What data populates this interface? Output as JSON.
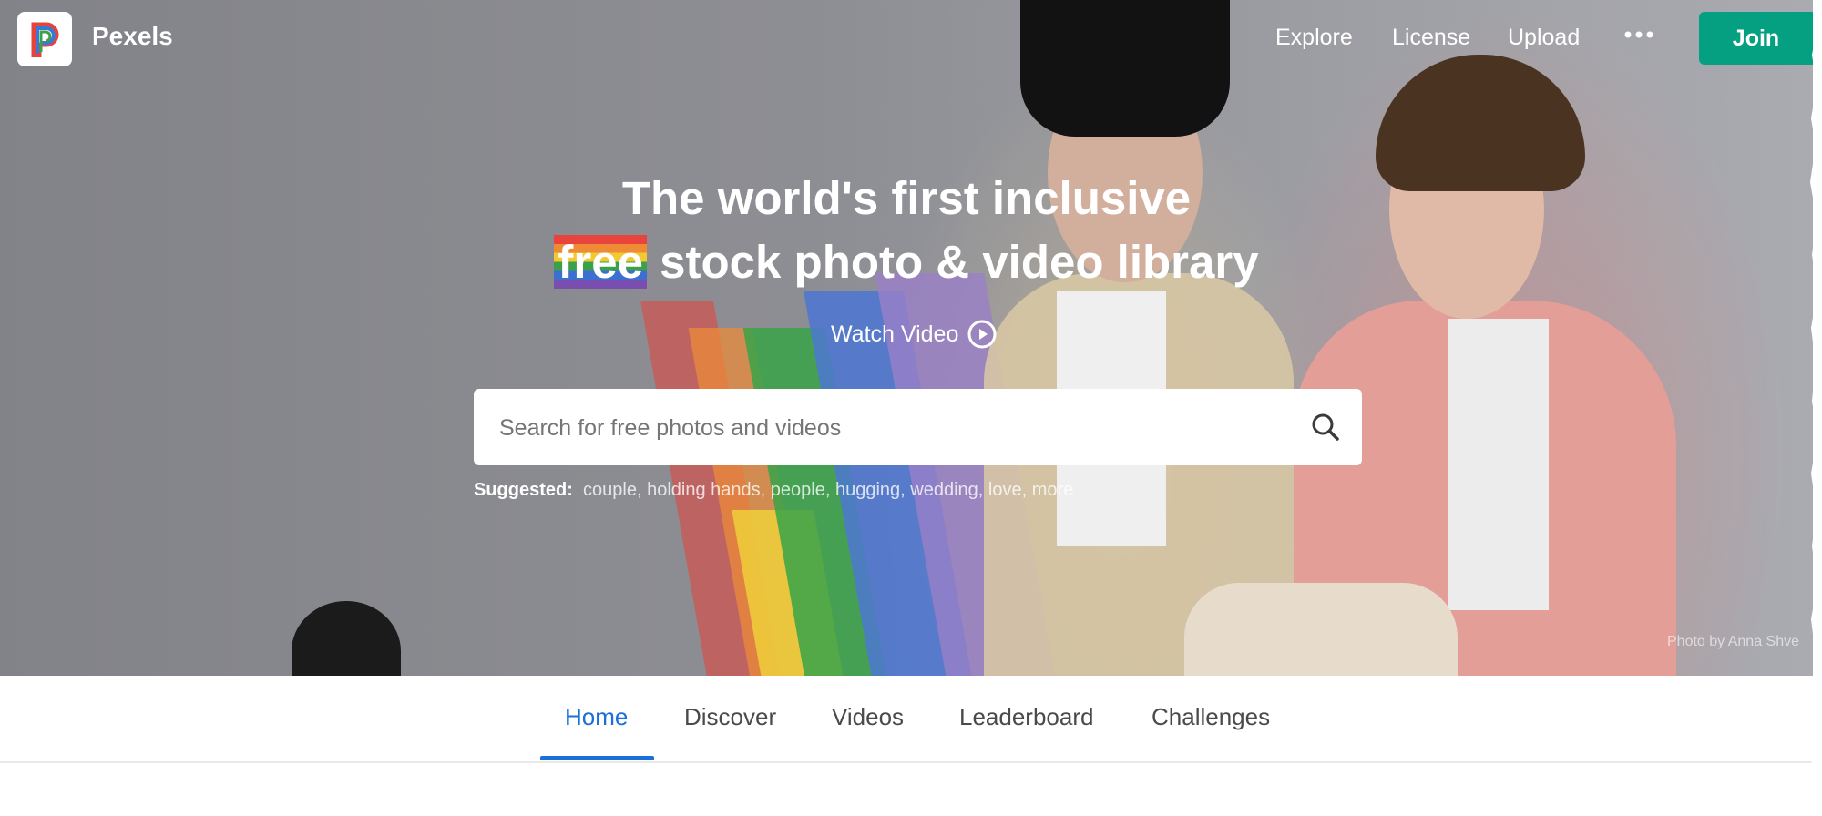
{
  "brand": {
    "name": "Pexels"
  },
  "nav": {
    "links": [
      "Explore",
      "License",
      "Upload"
    ],
    "more_icon": "more-horizontal-icon",
    "join_label": "Join"
  },
  "hero": {
    "headline_line1": "The world's first inclusive",
    "headline_free": "free",
    "headline_line2_rest": " stock photo & video library",
    "watch_video_label": "Watch Video",
    "watch_video_icon": "play-circle-icon",
    "search": {
      "placeholder": "Search for free photos and videos",
      "value": "",
      "icon": "search-icon"
    },
    "suggested_label": "Suggested:",
    "suggestions": [
      "couple",
      "holding hands",
      "people",
      "hugging",
      "wedding",
      "love",
      "more"
    ],
    "photo_credit": "Photo by Anna Shve"
  },
  "tabs": {
    "items": [
      "Home",
      "Discover",
      "Videos",
      "Leaderboard",
      "Challenges"
    ],
    "active": "Home",
    "active_color": "#1b6fd8"
  },
  "colors": {
    "join_button": "#05a081",
    "active_tab": "#1b6fd8"
  }
}
